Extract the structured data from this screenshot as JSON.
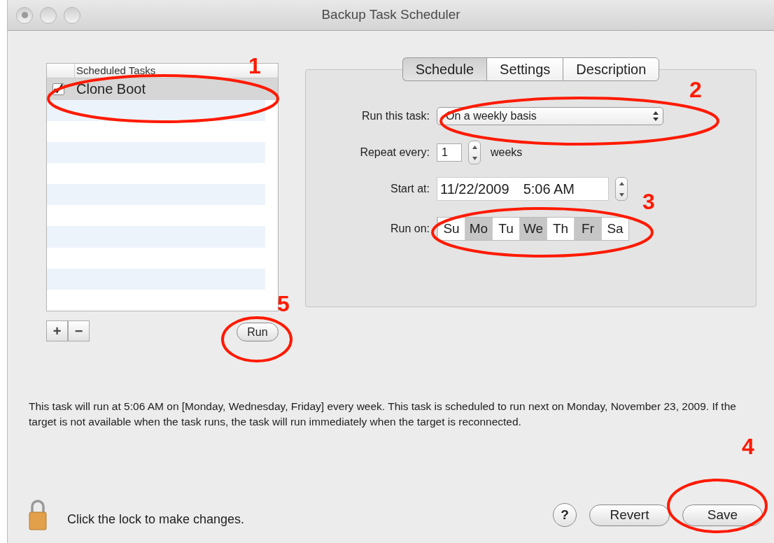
{
  "window": {
    "title": "Backup Task Scheduler"
  },
  "task_list": {
    "header": "Scheduled Tasks",
    "items": [
      {
        "name": "Clone Boot",
        "checked": true,
        "selected": true
      }
    ]
  },
  "list_buttons": [
    "+",
    "−"
  ],
  "run_button": "Run",
  "tabs": [
    {
      "label": "Schedule",
      "selected": true
    },
    {
      "label": "Settings",
      "selected": false
    },
    {
      "label": "Description",
      "selected": false
    }
  ],
  "form": {
    "run_this_task": {
      "label": "Run this task:",
      "value": "On a weekly basis"
    },
    "repeat_every": {
      "label": "Repeat every:",
      "value": "1",
      "unit": "weeks"
    },
    "start_at": {
      "label": "Start at:",
      "date": "11/22/2009",
      "time": "5:06 AM"
    },
    "run_on": {
      "label": "Run on:",
      "days": [
        {
          "label": "Su",
          "selected": false
        },
        {
          "label": "Mo",
          "selected": true
        },
        {
          "label": "Tu",
          "selected": false
        },
        {
          "label": "We",
          "selected": true
        },
        {
          "label": "Th",
          "selected": false
        },
        {
          "label": "Fr",
          "selected": true
        },
        {
          "label": "Sa",
          "selected": false
        }
      ]
    }
  },
  "description": "This task will run at 5:06 AM on [Monday, Wednesday, Friday] every week. This task is scheduled to run next on Monday, November 23, 2009. If the target is not available when the task runs, the task will run immediately when the target is reconnected.",
  "lock_text": "Click the lock to make changes.",
  "help_button": "?",
  "buttons": [
    "Revert",
    "Save"
  ],
  "annotations": [
    {
      "label": "1"
    },
    {
      "label": "2"
    },
    {
      "label": "3"
    },
    {
      "label": "4"
    },
    {
      "label": "5"
    }
  ]
}
